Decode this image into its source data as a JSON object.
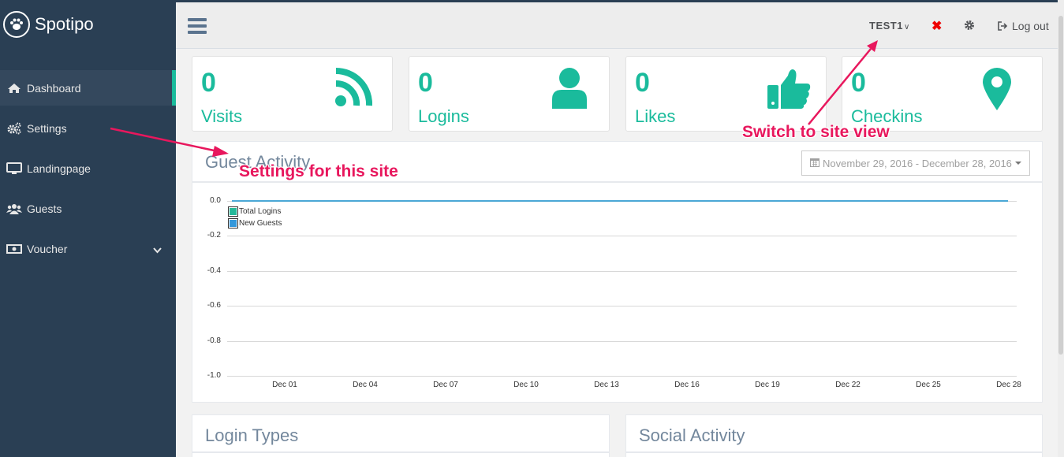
{
  "brand": {
    "name": "Spotipo",
    "logo_icon": "paw-icon"
  },
  "sidebar": {
    "items": [
      {
        "label": "Dashboard",
        "icon": "home-icon",
        "active": true
      },
      {
        "label": "Settings",
        "icon": "gears-icon"
      },
      {
        "label": "Landingpage",
        "icon": "desktop-icon"
      },
      {
        "label": "Guests",
        "icon": "users-icon"
      },
      {
        "label": "Voucher",
        "icon": "money-icon",
        "has_submenu": true
      }
    ]
  },
  "topbar": {
    "site_name": "TEST1",
    "logout_label": "Log out"
  },
  "stats": [
    {
      "value": "0",
      "label": "Visits",
      "icon": "rss-icon"
    },
    {
      "value": "0",
      "label": "Logins",
      "icon": "user-icon"
    },
    {
      "value": "0",
      "label": "Likes",
      "icon": "thumbs-up-icon"
    },
    {
      "value": "0",
      "label": "Checkins",
      "icon": "map-marker-icon"
    }
  ],
  "guest_activity": {
    "title": "Guest Activity",
    "date_range": "November 29, 2016 - December 28, 2016"
  },
  "chart_data": {
    "type": "line",
    "x": [
      "Dec 01",
      "Dec 04",
      "Dec 07",
      "Dec 10",
      "Dec 13",
      "Dec 16",
      "Dec 19",
      "Dec 22",
      "Dec 25",
      "Dec 28"
    ],
    "yticks": [
      "0.0",
      "-0.2",
      "-0.4",
      "-0.6",
      "-0.8",
      "-1.0"
    ],
    "ylim": [
      -1.0,
      0.0
    ],
    "series": [
      {
        "name": "Total Logins",
        "color": "#26b99a",
        "values": [
          0,
          0,
          0,
          0,
          0,
          0,
          0,
          0,
          0,
          0
        ]
      },
      {
        "name": "New Guests",
        "color": "#3498db",
        "values": [
          0,
          0,
          0,
          0,
          0,
          0,
          0,
          0,
          0,
          0
        ]
      }
    ],
    "grid": true,
    "legend": "top-left"
  },
  "panels": {
    "login_types": "Login Types",
    "social_activity": "Social Activity"
  },
  "annotations": {
    "settings_note": "Settings for this site",
    "switch_note": "Switch to site view",
    "color": "#e8175d"
  },
  "colors": {
    "accent": "#1abb9c",
    "sidebar": "#2a3f54"
  }
}
